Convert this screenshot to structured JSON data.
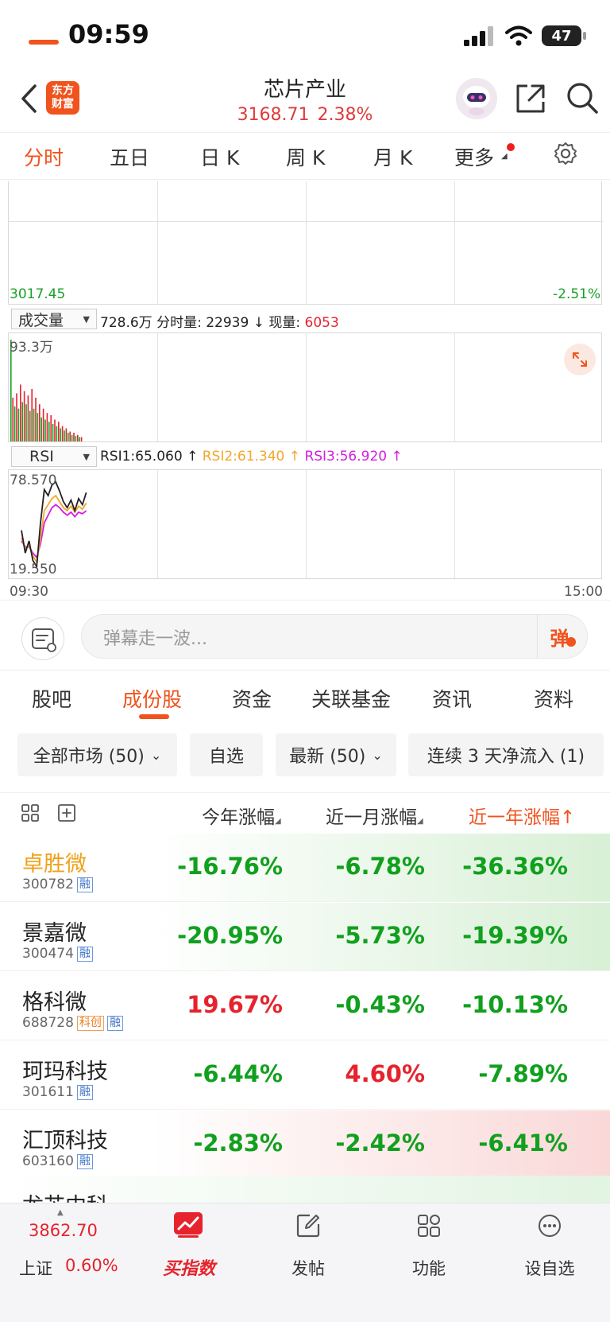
{
  "status_bar": {
    "time": "09:59",
    "battery": "47"
  },
  "header": {
    "logo_line1": "东方",
    "logo_line2": "财富",
    "title": "芯片产业",
    "index_value": "3168.71",
    "index_change": "2.38%"
  },
  "period_tabs": [
    "分时",
    "五日",
    "日 K",
    "周 K",
    "月 K",
    "更多"
  ],
  "chart": {
    "price_low": "3017.45",
    "price_low_pct": "-2.51%",
    "volume": {
      "selector": "成交量",
      "total": "728.6万",
      "minute_label": "分时量: 22939",
      "minute_arrow": "↓",
      "current_label": "现量:",
      "current_value": "6053",
      "max_label": "93.3万",
      "bars": [
        93,
        40,
        32,
        44,
        30,
        52,
        36,
        46,
        34,
        42,
        28,
        48,
        30,
        40,
        26,
        34,
        22,
        30,
        20,
        26,
        18,
        24,
        16,
        20,
        14,
        18,
        12,
        14,
        10,
        12,
        8,
        9,
        6,
        8,
        5,
        6,
        4,
        4
      ]
    },
    "rsi": {
      "selector": "RSI",
      "rsi1": "RSI1:65.060",
      "rsi2": "RSI2:61.340",
      "rsi3": "RSI3:56.920",
      "arrow": "↑",
      "max_label": "78.570",
      "min_label": "19.550",
      "line1": [
        45,
        30,
        38,
        25,
        21,
        50,
        72,
        68,
        75,
        77,
        71,
        64,
        60,
        65,
        58,
        66,
        62,
        70
      ],
      "line2": [
        40,
        33,
        35,
        28,
        24,
        40,
        58,
        62,
        66,
        68,
        64,
        60,
        58,
        61,
        57,
        61,
        59,
        63
      ],
      "line3": [
        38,
        34,
        34,
        30,
        27,
        36,
        50,
        55,
        60,
        62,
        60,
        57,
        55,
        57,
        54,
        57,
        56,
        58
      ]
    },
    "time_start": "09:30",
    "time_end": "15:00"
  },
  "danmaku": {
    "placeholder": "弹幕走一波...",
    "button": "弹"
  },
  "section_tabs": [
    "股吧",
    "成份股",
    "资金",
    "关联基金",
    "资讯",
    "资料"
  ],
  "filters": [
    "全部市场 (50)",
    "自选",
    "最新 (50)",
    "连续 3 天净流入 (1)"
  ],
  "table": {
    "headers": [
      "今年涨幅",
      "近一月涨幅",
      "近一年涨幅"
    ],
    "rows": [
      {
        "name": "卓胜微",
        "code": "300782",
        "tags": [
          "融"
        ],
        "ytd": "-16.76%",
        "m1": "-6.78%",
        "y1": "-36.36%",
        "highlight": "green",
        "name_color": "#f0a11a"
      },
      {
        "name": "景嘉微",
        "code": "300474",
        "tags": [
          "融"
        ],
        "ytd": "-20.95%",
        "m1": "-5.73%",
        "y1": "-19.39%",
        "highlight": "green"
      },
      {
        "name": "格科微",
        "code": "688728",
        "tags": [
          "科创",
          "融"
        ],
        "ytd": "19.67%",
        "m1": "-0.43%",
        "y1": "-10.13%",
        "highlight": "none"
      },
      {
        "name": "珂玛科技",
        "code": "301611",
        "tags": [
          "融"
        ],
        "ytd": "-6.44%",
        "m1": "4.60%",
        "y1": "-7.89%",
        "highlight": "none"
      },
      {
        "name": "汇顶科技",
        "code": "603160",
        "tags": [
          "融"
        ],
        "ytd": "-2.83%",
        "m1": "-2.42%",
        "y1": "-6.41%",
        "highlight": "red"
      }
    ],
    "partial_row_name": "龙芯中科"
  },
  "bottom_bar": {
    "index_value": "3862.70",
    "index_name": "上证",
    "index_change": "0.60%",
    "items": [
      "买指数",
      "发帖",
      "功能",
      "设自选"
    ]
  },
  "colors": {
    "accent": "#f0531d",
    "up": "#e6232d",
    "down": "#11a01e",
    "rsi2": "#f4a62a",
    "rsi3": "#d21ee0"
  }
}
